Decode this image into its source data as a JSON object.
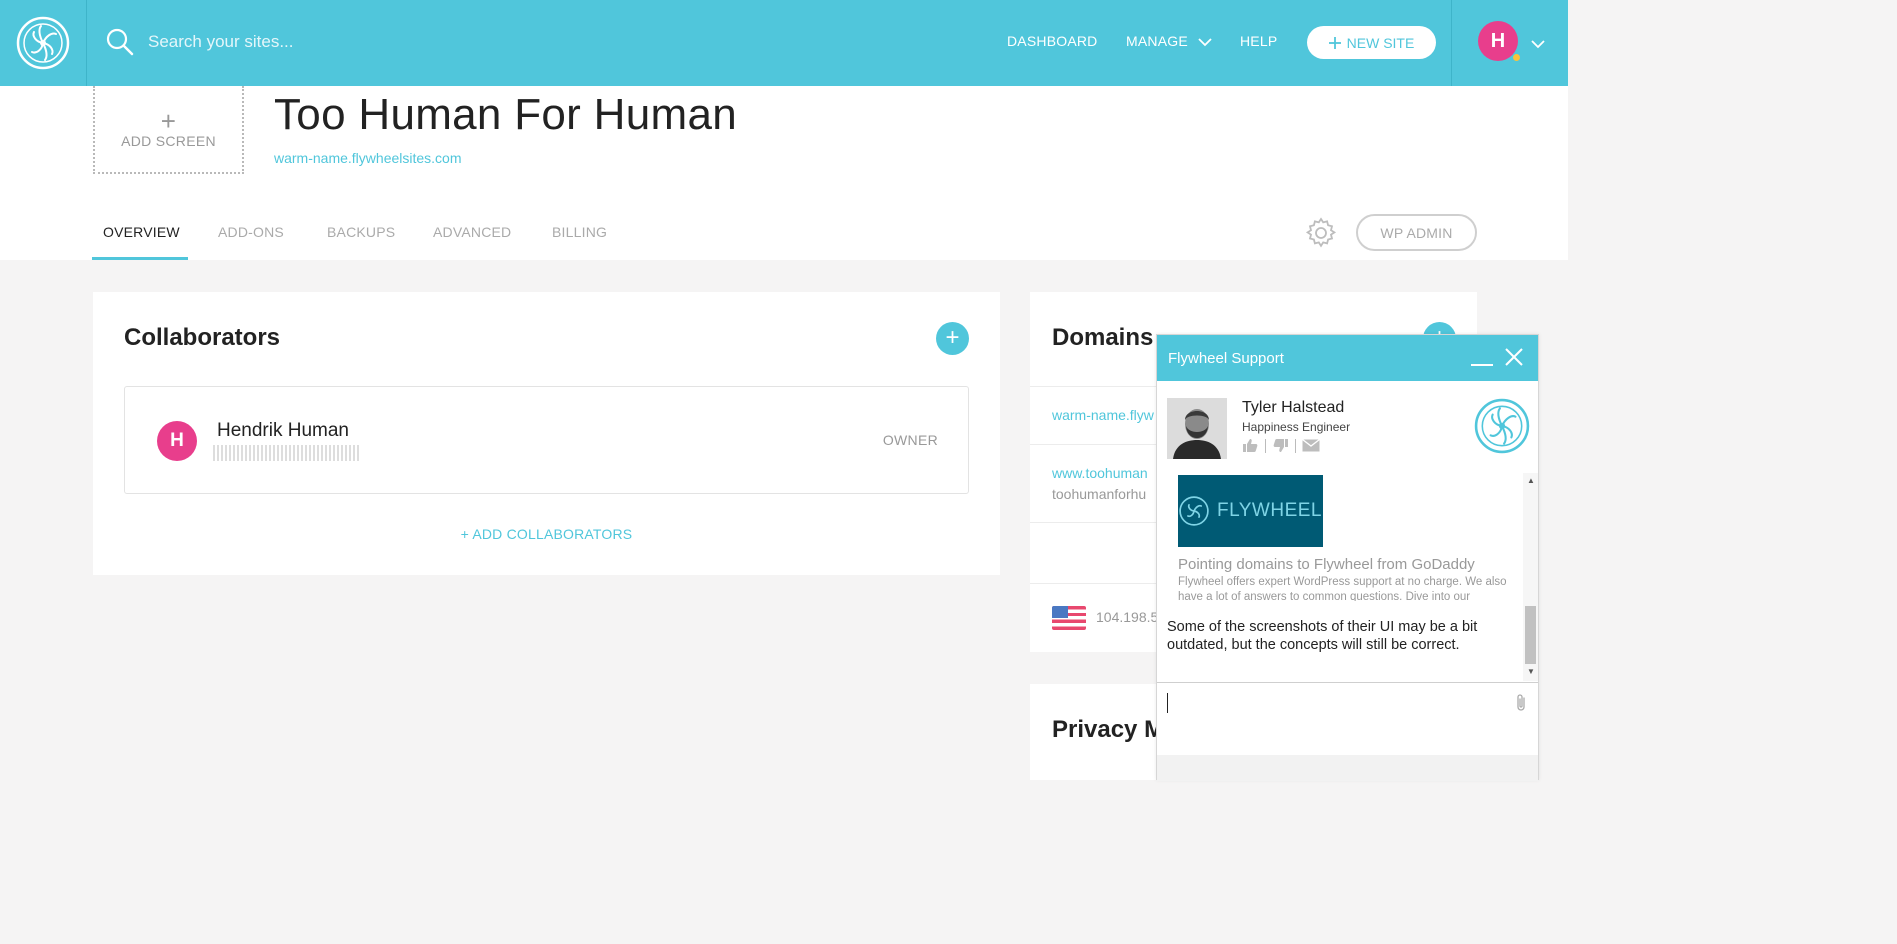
{
  "topbar": {
    "search_placeholder": "Search your sites...",
    "nav": {
      "dashboard": "DASHBOARD",
      "manage": "MANAGE",
      "help": "HELP",
      "new_site": "NEW SITE"
    },
    "avatar_letter": "H",
    "icons": [
      "flywheel-logo-icon",
      "search-icon",
      "chevron-down-icon",
      "plus-icon"
    ]
  },
  "site": {
    "add_screen": "ADD SCREEN",
    "title": "Too Human For Human",
    "url": "warm-name.flywheelsites.com",
    "tabs": [
      "OVERVIEW",
      "ADD-ONS",
      "BACKUPS",
      "ADVANCED",
      "BILLING"
    ],
    "active_tab": "OVERVIEW",
    "wp_admin": "WP ADMIN"
  },
  "collaborators": {
    "title": "Collaborators",
    "items": [
      {
        "initial": "H",
        "name": "Hendrik Human",
        "role": "OWNER"
      }
    ],
    "add_label": "+ ADD COLLABORATORS"
  },
  "domains": {
    "title": "Domains",
    "primary": "warm-name.flyw",
    "secondary": "www.toohuman",
    "secondary_sub": "toohumanforhu",
    "ip": "104.198.5"
  },
  "privacy": {
    "title": "Privacy M"
  },
  "chat": {
    "header": "Flywheel Support",
    "agent_name": "Tyler Halstead",
    "agent_role": "Happiness Engineer",
    "banner_text": "FLYWHEEL",
    "article_title": "Pointing domains to Flywheel from GoDaddy",
    "article_snippet": "Flywheel offers expert WordPress support at no charge. We also have a lot of answers to common questions. Dive into our",
    "message": "Some of the screenshots of their UI may be a bit outdated, but the concepts will still be correct."
  },
  "colors": {
    "brand": "#50c6db",
    "avatar": "#e83e8c",
    "status_dot": "#f9c33b",
    "banner": "#005a74"
  }
}
